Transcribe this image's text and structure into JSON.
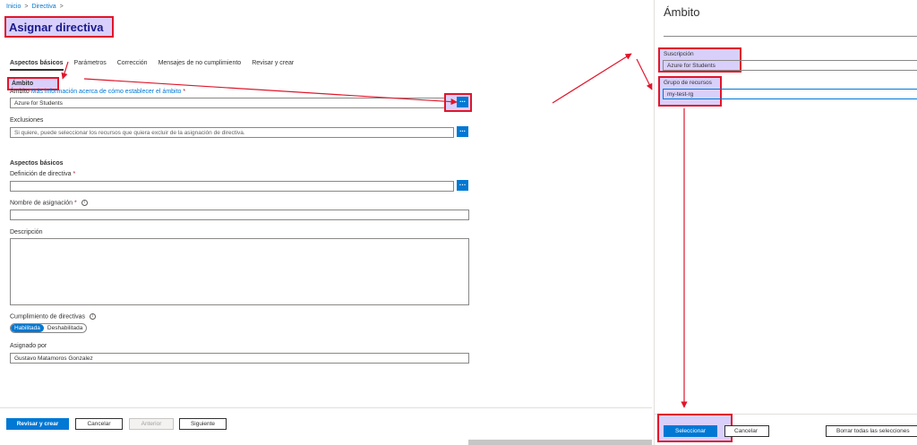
{
  "breadcrumb": {
    "items": [
      "Inicio",
      "Directiva"
    ],
    "sep": ">"
  },
  "page_title": "Asignar directiva",
  "tabs": [
    "Aspectos básicos",
    "Parámetros",
    "Corrección",
    "Mensajes de no cumplimiento",
    "Revisar y crear"
  ],
  "scope": {
    "section": "Ámbito",
    "label": "Ámbito",
    "link": "Más información acerca de cómo establecer el ámbito",
    "required": "*",
    "value": "Azure for Students",
    "browse": "..."
  },
  "exclusions": {
    "label": "Exclusiones",
    "placeholder": "Si quiere, puede seleccionar los recursos que quiera excluir de la asignación de directiva.",
    "browse": "..."
  },
  "basics": {
    "heading": "Aspectos básicos",
    "policy_definition_label": "Definición de directiva",
    "assignment_name_label": "Nombre de asignación",
    "description_label": "Descripción",
    "required": "*",
    "info": "i"
  },
  "enforcement": {
    "label": "Cumplimiento de directivas",
    "options": [
      "Habilitada",
      "Deshabilitada"
    ],
    "info": "i"
  },
  "assigned_by": {
    "label": "Asignado por",
    "value": "Gustavo Matamoros Gonzalez"
  },
  "footer": {
    "review": "Revisar y crear",
    "cancel": "Cancelar",
    "previous": "Anterior",
    "next": "Siguiente"
  },
  "panel": {
    "title": "Ámbito",
    "subscription_label": "Suscripción",
    "subscription_value": "Azure for Students",
    "rg_label": "Grupo de recursos",
    "rg_value": "my-test-rg",
    "select": "Seleccionar",
    "cancel": "Cancelar",
    "clear": "Borrar todas las selecciones"
  },
  "colors": {
    "accent": "#0078d4",
    "highlight": "#d8d0fb",
    "annotation": "#e0162b"
  }
}
